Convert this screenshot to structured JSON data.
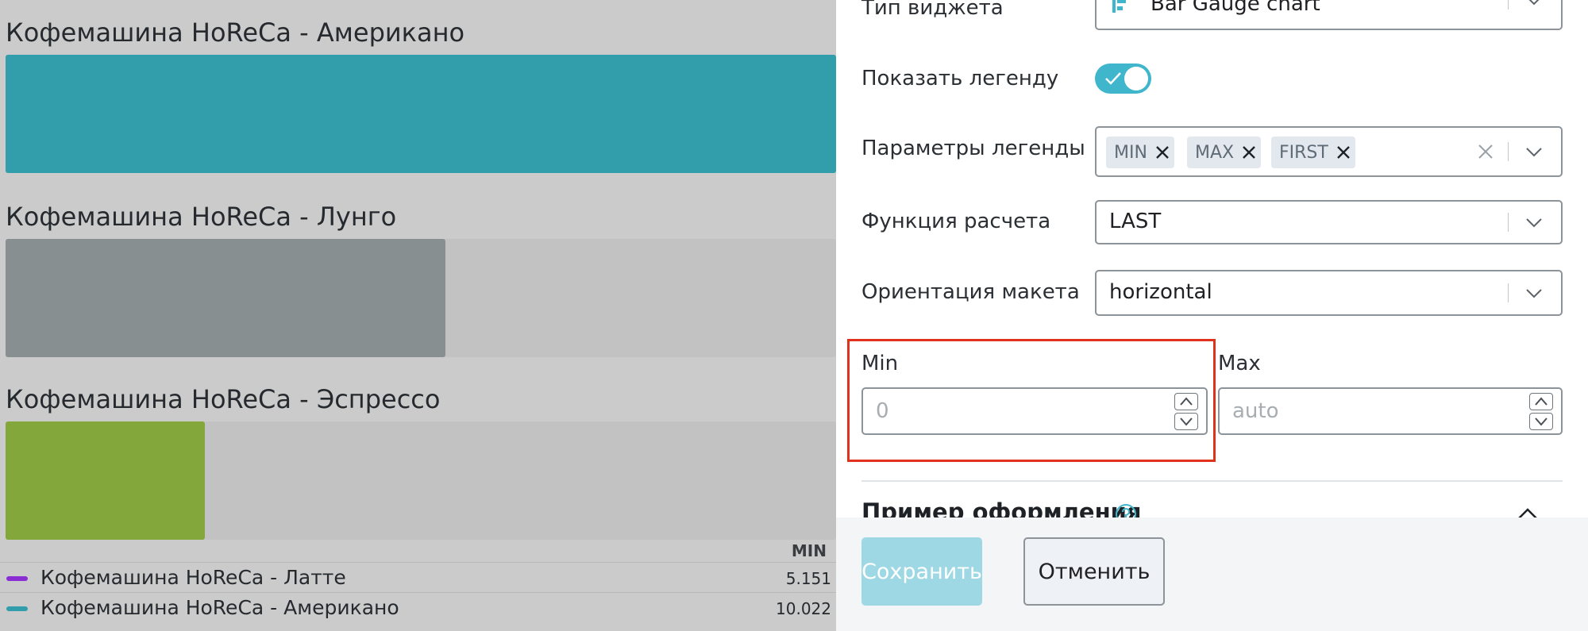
{
  "chart": {
    "gauges": [
      {
        "title": "Кофемашина HoReCa - Американо",
        "fill_fraction": 1.0,
        "color": "#329dab"
      },
      {
        "title": "Кофемашина HoReCa - Лунго",
        "fill_fraction": 0.53,
        "color": "#888f91"
      },
      {
        "title": "Кофемашина HoReCa - Эспрессо",
        "fill_fraction": 0.24,
        "color": "#84a73c"
      }
    ],
    "legend": {
      "column_header": "MIN",
      "rows": [
        {
          "name": "Кофемашина HoReCa - Латте",
          "value": "5.151",
          "color": "#8a2ed3"
        },
        {
          "name": "Кофемашина HoReCa - Американо",
          "value": "10.022",
          "color": "#329dab"
        }
      ]
    }
  },
  "panel": {
    "widget_type": {
      "label": "Тип виджета",
      "value": "Bar Gauge chart",
      "icon": "bar-gauge-icon"
    },
    "show_legend": {
      "label": "Показать легенду",
      "enabled": true
    },
    "legend_params": {
      "label": "Параметры легенды",
      "tags": [
        "MIN",
        "MAX",
        "FIRST"
      ]
    },
    "calc_function": {
      "label": "Функция расчета",
      "value": "LAST"
    },
    "layout_orientation": {
      "label": "Ориентация макета",
      "value": "horizontal"
    },
    "min": {
      "label": "Min",
      "placeholder": "0"
    },
    "max": {
      "label": "Max",
      "placeholder": "auto"
    },
    "preview_section": {
      "title": "Пример оформления",
      "help_icon": "help-circle-icon",
      "collapse_icon": "chevron-up-icon"
    },
    "buttons": {
      "save": "Сохранить",
      "cancel": "Отменить"
    },
    "colors": {
      "accent": "#3fb6cb",
      "save_disabled": "#9dd8e4",
      "highlight": "#e0311c"
    }
  }
}
